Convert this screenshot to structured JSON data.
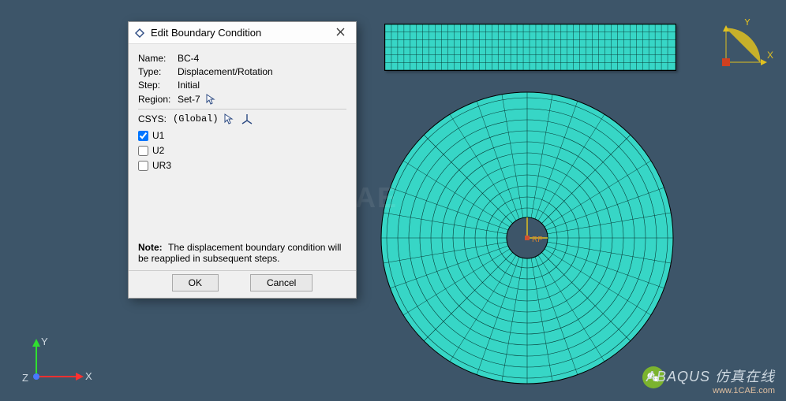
{
  "dialog": {
    "title": "Edit Boundary Condition",
    "fields": {
      "name_label": "Name:",
      "name_value": "BC-4",
      "type_label": "Type:",
      "type_value": "Displacement/Rotation",
      "step_label": "Step:",
      "step_value": "Initial",
      "region_label": "Region:",
      "region_value": "Set-7"
    },
    "csys": {
      "label": "CSYS:",
      "value": "(Global)"
    },
    "dofs": {
      "u1": {
        "label": "U1",
        "checked": true
      },
      "u2": {
        "label": "U2",
        "checked": false
      },
      "ur3": {
        "label": "UR3",
        "checked": false
      }
    },
    "note_prefix": "Note:",
    "note_text": "The displacement boundary condition will be reapplied in subsequent steps.",
    "ok_label": "OK",
    "cancel_label": "Cancel"
  },
  "triad": {
    "x": "X",
    "y": "Y",
    "z": "Z"
  },
  "graphics": {
    "mesh_color": "#37d6c6",
    "center_label": "RP"
  },
  "watermark": "1CAE",
  "brand": {
    "line1": "ABAQUS 仿真在线",
    "line2": "www.1CAE.com"
  }
}
